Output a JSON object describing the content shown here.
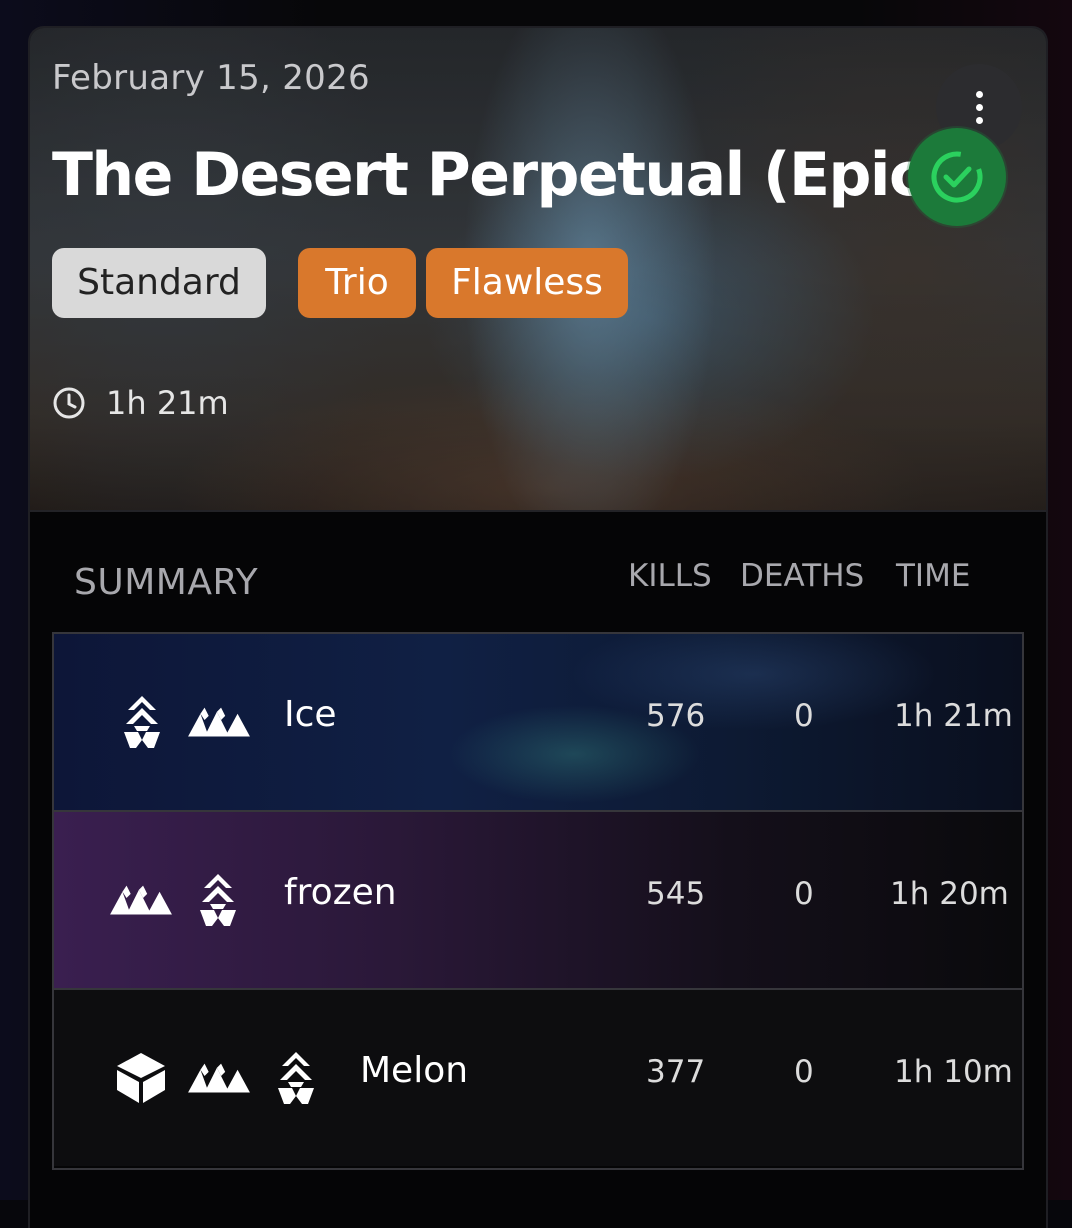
{
  "header": {
    "date": "February 15, 2026",
    "title": "The Desert Perpetual (Epic)",
    "status": "complete",
    "tags": [
      {
        "label": "Standard",
        "color": "#d9d9d9"
      },
      {
        "label": "Trio",
        "color": "#d9782c"
      },
      {
        "label": "Flawless",
        "color": "#d9782c"
      }
    ],
    "duration": "1h 21m",
    "menu_icon": "more-vertical-icon",
    "status_icon": "check-circle-icon",
    "status_color": "#1c7a3a"
  },
  "summary": {
    "label": "SUMMARY",
    "columns": [
      "KILLS",
      "DEATHS",
      "TIME"
    ],
    "players": [
      {
        "name": "Ice",
        "classes": [
          "warlock",
          "hunter"
        ],
        "kills": "576",
        "deaths": "0",
        "time": "1h 21m"
      },
      {
        "name": "frozen",
        "classes": [
          "hunter",
          "warlock"
        ],
        "kills": "545",
        "deaths": "0",
        "time": "1h 20m"
      },
      {
        "name": "Melon",
        "classes": [
          "titan",
          "hunter",
          "warlock"
        ],
        "kills": "377",
        "deaths": "0",
        "time": "1h 10m"
      }
    ]
  }
}
